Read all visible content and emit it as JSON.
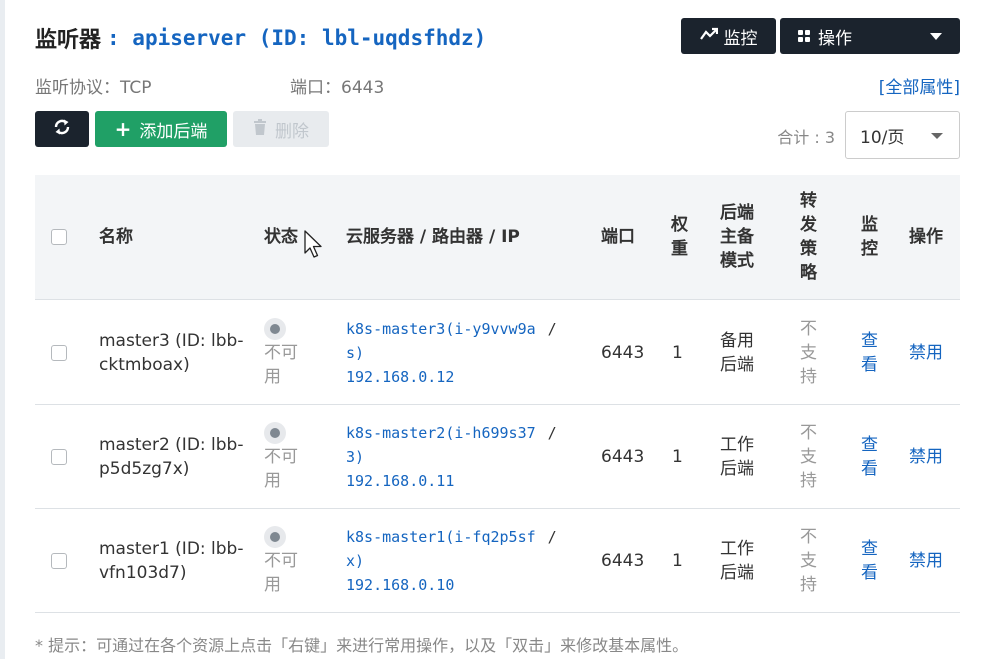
{
  "header": {
    "title_label": "监听器",
    "title_rest": ": apiserver (ID: lbl-uqdsfhdz)",
    "monitor_button": "监控",
    "ops_button": "操作"
  },
  "meta": {
    "protocol": "监听协议：TCP",
    "port": "端口：6443",
    "all_props": "[全部属性]"
  },
  "toolbar": {
    "add_label": "添加后端",
    "add_icon": "+",
    "delete_label": "删除",
    "total": "合计 : 3",
    "page_size": "10/页"
  },
  "table": {
    "headers": {
      "name": "名称",
      "status": "状态",
      "server": "云服务器 / 路由器 / IP",
      "port": "端口",
      "weight": [
        "权",
        "重"
      ],
      "mode": [
        "后端",
        "主备",
        "模式"
      ],
      "policy": [
        "转",
        "发",
        "策",
        "略"
      ],
      "monitor": [
        "监",
        "控"
      ],
      "action": "操作"
    },
    "rows": [
      {
        "name": [
          "master3 (ID: lbb-",
          "cktmboax)"
        ],
        "status": [
          "不可",
          "用"
        ],
        "server": [
          "k8s-master3(i-y9vvw9a",
          "s)"
        ],
        "server_sep": "/",
        "ip": "192.168.0.12",
        "port": "6443",
        "weight": "1",
        "mode": [
          "备用",
          "后端"
        ],
        "policy": [
          "不",
          "支",
          "持"
        ],
        "view": [
          "查",
          "看"
        ],
        "action": "禁用"
      },
      {
        "name": [
          "master2 (ID: lbb-",
          "p5d5zg7x)"
        ],
        "status": [
          "不可",
          "用"
        ],
        "server": [
          "k8s-master2(i-h699s37",
          "3)"
        ],
        "server_sep": "/",
        "ip": "192.168.0.11",
        "port": "6443",
        "weight": "1",
        "mode": [
          "工作",
          "后端"
        ],
        "policy": [
          "不",
          "支",
          "持"
        ],
        "view": [
          "查",
          "看"
        ],
        "action": "禁用"
      },
      {
        "name": [
          "master1 (ID: lbb-",
          "vfn103d7)"
        ],
        "status": [
          "不可",
          "用"
        ],
        "server": [
          "k8s-master1(i-fq2p5sf",
          "x)"
        ],
        "server_sep": "/",
        "ip": "192.168.0.10",
        "port": "6443",
        "weight": "1",
        "mode": [
          "工作",
          "后端"
        ],
        "policy": [
          "不",
          "支",
          "持"
        ],
        "view": [
          "查",
          "看"
        ],
        "action": "禁用"
      }
    ]
  },
  "footer": {
    "tip": "* 提示：可通过在各个资源上点击「右键」来进行常用操作，以及「双击」来修改基本属性。"
  },
  "icons": {
    "monitor": "trend-line-icon",
    "ops": "grid-icon",
    "refresh": "refresh-icon",
    "delete": "trash-icon",
    "status": "status-dot-icon"
  },
  "colors": {
    "accent": "#1565c0",
    "dark_button": "#1b232d",
    "add_button": "#20a066",
    "status_dot": "#7f8891"
  }
}
